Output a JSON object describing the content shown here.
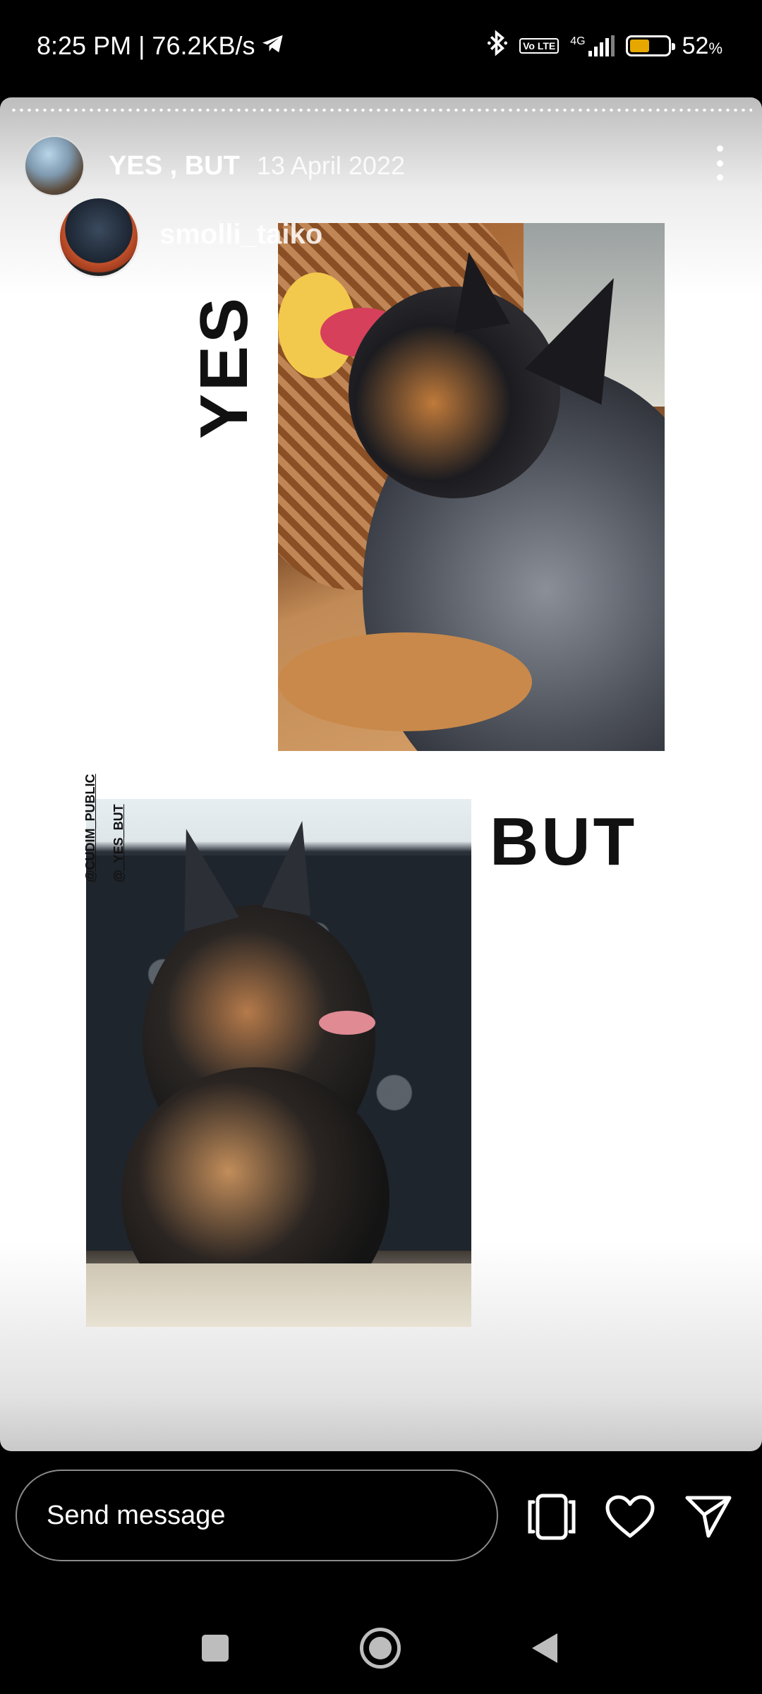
{
  "status_bar": {
    "time_network": "8:25 PM | 76.2KB/s",
    "volte": "Vo LTE",
    "network_type": "4G",
    "battery_percent": "52",
    "battery_unit": "%",
    "battery_level": 0.52,
    "battery_color": "#e6a700"
  },
  "story": {
    "account": "YES , BUT",
    "date": "13 April 2022",
    "inner_username": "smolli_taiko",
    "yes_label": "YES",
    "but_label": "BUT",
    "credit_1": "@CUDIM_PUBLIC",
    "credit_2": "@_YES_BUT"
  },
  "bottom_bar": {
    "message_placeholder": "Send message"
  },
  "icons": [
    "telegram-icon",
    "bluetooth-icon",
    "signal-icon",
    "battery-icon",
    "more-icon",
    "sticker-icon",
    "heart-icon",
    "send-icon",
    "recents-icon",
    "home-icon",
    "back-icon"
  ]
}
